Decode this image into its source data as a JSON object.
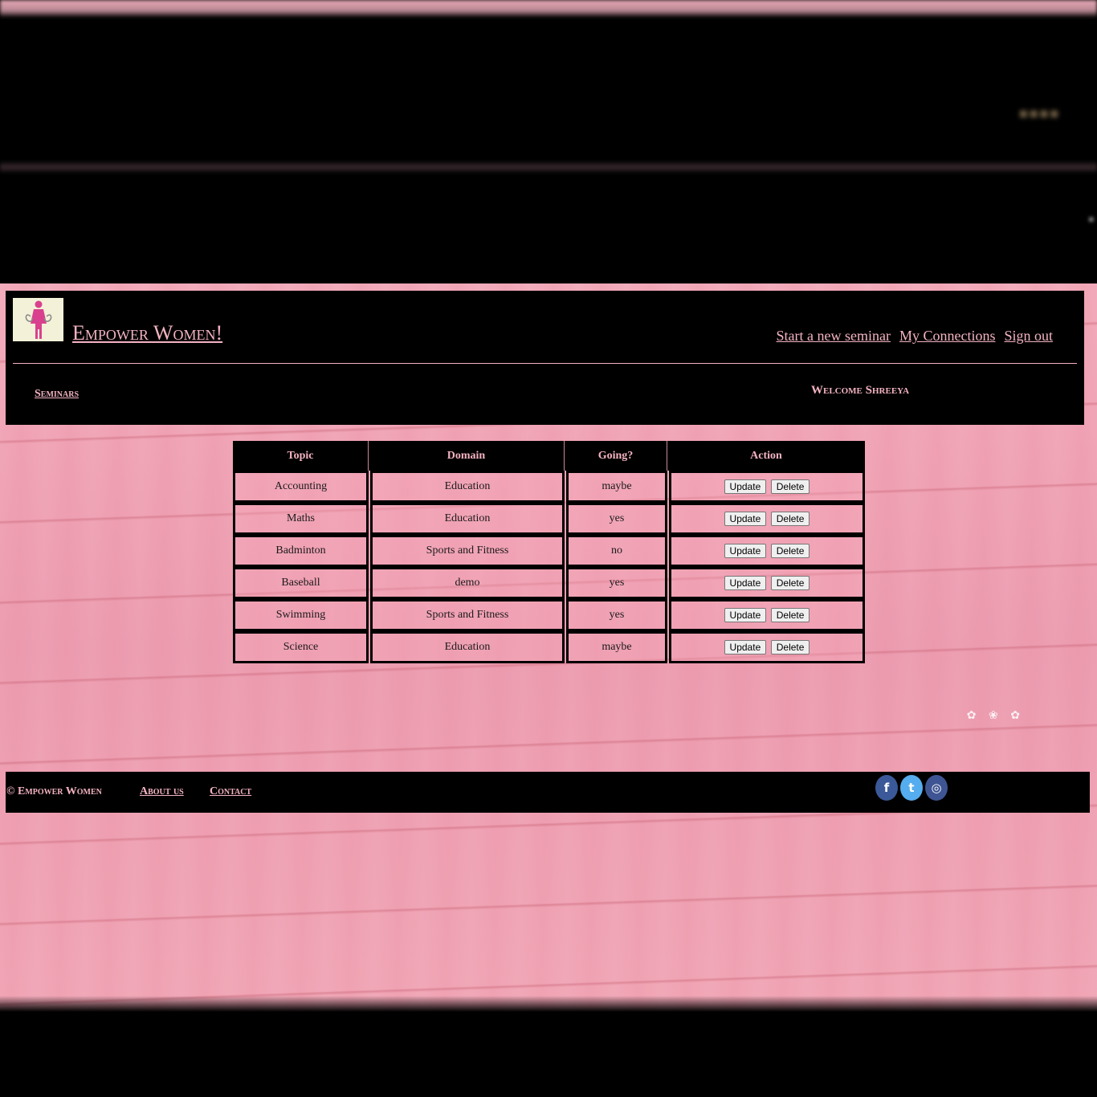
{
  "site": {
    "title": "Empower Women!",
    "nav": [
      {
        "label": "Start a new seminar"
      },
      {
        "label": "My Connections"
      },
      {
        "label": "Sign out"
      }
    ],
    "subnav_label": "Seminars",
    "welcome": "Welcome Shreeya"
  },
  "table": {
    "headers": [
      "Topic",
      "Domain",
      "Going?",
      "Action"
    ],
    "rows": [
      {
        "topic": "Accounting",
        "domain": "Education",
        "going": "maybe"
      },
      {
        "topic": "Maths",
        "domain": "Education",
        "going": "yes"
      },
      {
        "topic": "Badminton",
        "domain": "Sports and Fitness",
        "going": "no"
      },
      {
        "topic": "Baseball",
        "domain": "demo",
        "going": "yes"
      },
      {
        "topic": "Swimming",
        "domain": "Sports and Fitness",
        "going": "yes"
      },
      {
        "topic": "Science",
        "domain": "Education",
        "going": "maybe"
      }
    ],
    "update_label": "Update",
    "delete_label": "Delete"
  },
  "footer": {
    "copyright": "© Empower Women",
    "about": "About us",
    "contact": "Contact",
    "social": [
      {
        "icon": "facebook-icon",
        "glyph": "f",
        "color": "#3b5998"
      },
      {
        "icon": "twitter-icon",
        "glyph": "t",
        "color": "#55acee"
      },
      {
        "icon": "instagram-icon",
        "glyph": "◎",
        "color": "#3f5593"
      }
    ]
  },
  "colors": {
    "accent": "#f4b3c2",
    "background": "#000000"
  }
}
